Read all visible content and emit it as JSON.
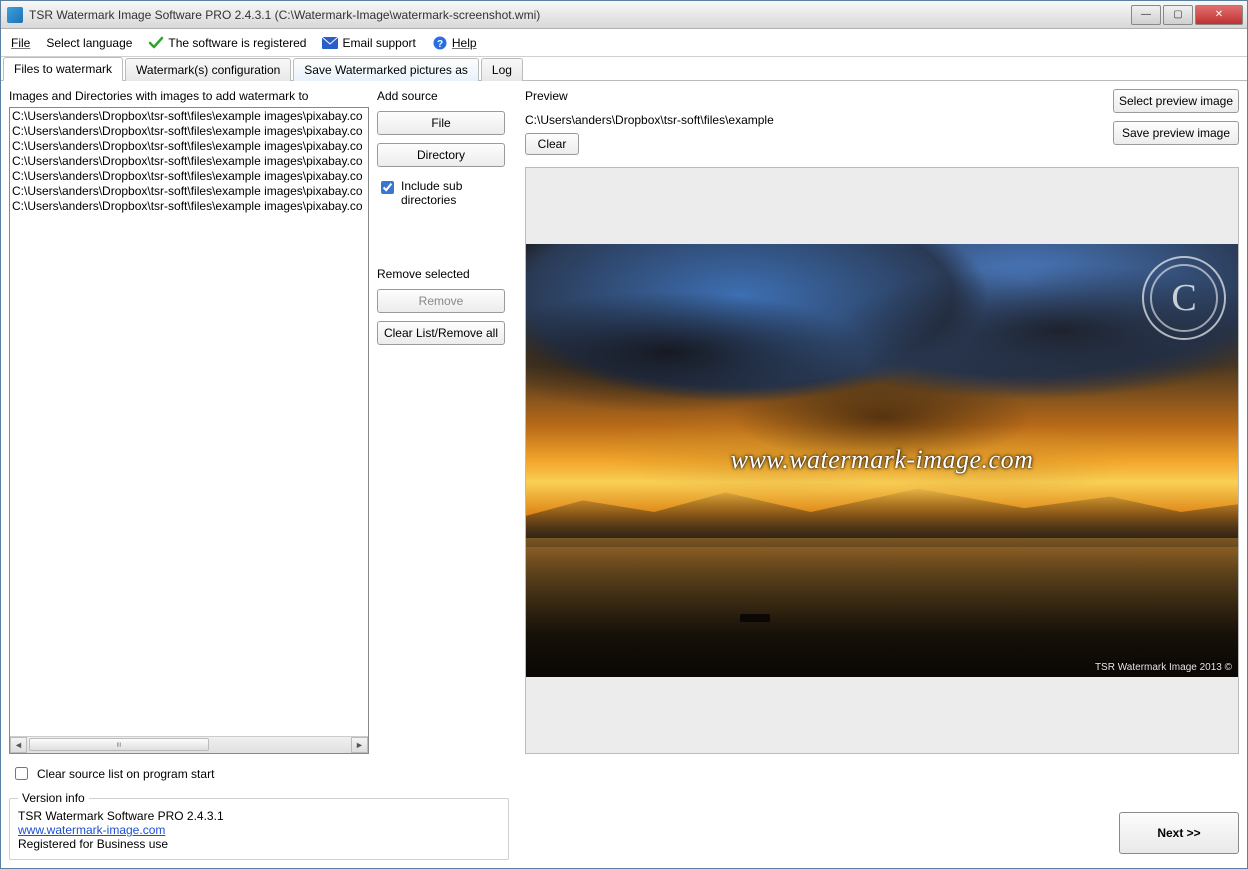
{
  "titlebar": {
    "title": "TSR Watermark Image Software PRO 2.4.3.1 (C:\\Watermark-Image\\watermark-screenshot.wmi)"
  },
  "menubar": {
    "file": "File",
    "language": "Select language",
    "registered": "The software is registered",
    "email": "Email support",
    "help": "Help"
  },
  "tabs": {
    "files": "Files to watermark",
    "config": "Watermark(s) configuration",
    "saveas": "Save Watermarked pictures as",
    "log": "Log"
  },
  "leftcol": {
    "label": "Images and Directories with images to add watermark to",
    "rows": [
      "C:\\Users\\anders\\Dropbox\\tsr-soft\\files\\example images\\pixabay.co",
      "C:\\Users\\anders\\Dropbox\\tsr-soft\\files\\example images\\pixabay.co",
      "C:\\Users\\anders\\Dropbox\\tsr-soft\\files\\example images\\pixabay.co",
      "C:\\Users\\anders\\Dropbox\\tsr-soft\\files\\example images\\pixabay.co",
      "C:\\Users\\anders\\Dropbox\\tsr-soft\\files\\example images\\pixabay.co",
      "C:\\Users\\anders\\Dropbox\\tsr-soft\\files\\example images\\pixabay.co",
      "C:\\Users\\anders\\Dropbox\\tsr-soft\\files\\example images\\pixabay.co"
    ]
  },
  "midcol": {
    "add_source": "Add source",
    "file_btn": "File",
    "directory_btn": "Directory",
    "include_sub": "Include sub directories",
    "remove_selected": "Remove selected",
    "remove_btn": "Remove",
    "clear_btn": "Clear List/Remove all"
  },
  "preview": {
    "label": "Preview",
    "path": "C:\\Users\\anders\\Dropbox\\tsr-soft\\files\\example",
    "clear_btn": "Clear",
    "select_btn": "Select preview image",
    "save_btn": "Save preview image",
    "watermark_text": "www.watermark-image.com",
    "corner_text": "TSR Watermark Image 2013 ©"
  },
  "lower": {
    "clear_on_start": "Clear source list on program start",
    "version_legend": "Version info",
    "version_line": "TSR Watermark Software PRO 2.4.3.1",
    "link": "www.watermark-image.com",
    "reg_line": "Registered for Business use",
    "next": "Next >>"
  }
}
